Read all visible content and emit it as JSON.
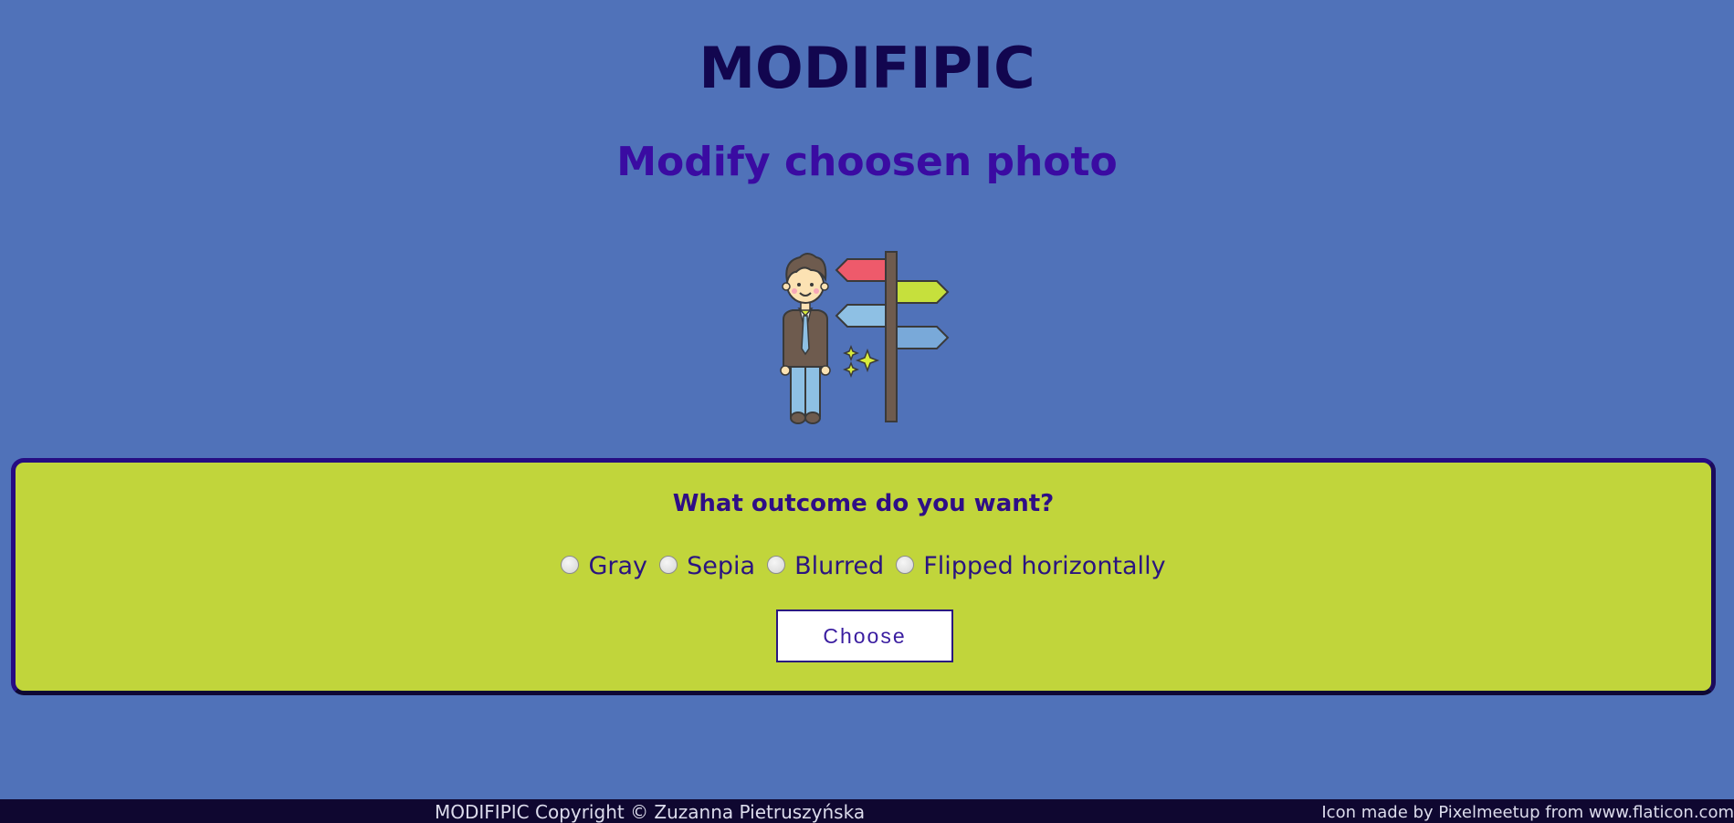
{
  "header": {
    "app_title": "MODIFIPIC",
    "subtitle": "Modify choosen photo"
  },
  "hero": {
    "icon": "person-signpost-icon"
  },
  "form": {
    "question": "What outcome do you want?",
    "options": [
      {
        "label": "Gray",
        "checked": false
      },
      {
        "label": "Sepia",
        "checked": false
      },
      {
        "label": "Blurred",
        "checked": false
      },
      {
        "label": "Flipped horizontally",
        "checked": false
      }
    ],
    "submit_label": "Choose"
  },
  "footer": {
    "copyright": "MODIFIPIC Copyright © Zuzanna Pietruszyńska",
    "credit": "Icon made by Pixelmeetup from www.flaticon.com"
  },
  "colors": {
    "background": "#5072b9",
    "panel": "#c1d53b",
    "title": "#12064f",
    "subtitle": "#3a0ba2",
    "footer": "#0f0730"
  }
}
